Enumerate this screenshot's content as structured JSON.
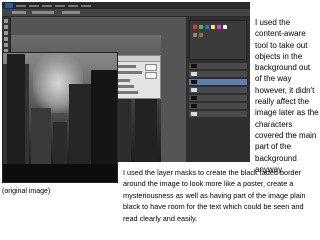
{
  "right_note": "I used the content-aware tool to take out objects in the background out of the way however, it didn't really affect the image later as the characters covered the main part of the background anyway.",
  "bottom_note": "I used the layer masks to create the black faded border around the image to look more like a poster, create a mysteriousness as well as having part of the image plain black to have room for the text which could be seen and read clearly and easily.",
  "original_caption": "(original image)",
  "colors": {
    "ps_background": "#3c3c3c",
    "ps_accent": "#1f5fa8",
    "text": "#000000"
  }
}
